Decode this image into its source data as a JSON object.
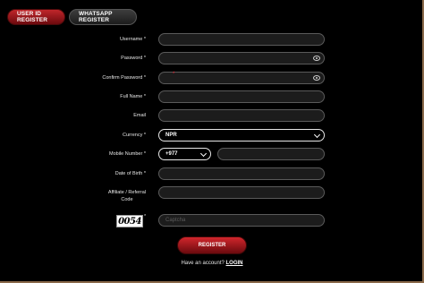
{
  "tabs": [
    {
      "label": "USER ID REGISTER",
      "active": true
    },
    {
      "label": "WHATSAPP REGISTER",
      "active": false
    }
  ],
  "form": {
    "username_label": "Username *",
    "password_label": "Password *",
    "confirm_password_label": "Confirm Password *",
    "confirm_password_hint": "*",
    "full_name_label": "Full Name *",
    "email_label": "Email",
    "currency_label": "Currency *",
    "currency_value": "NPR",
    "mobile_label": "Mobile Number *",
    "country_code": "+977",
    "dob_label": "Date of Birth *",
    "affiliate_label_line1": "Affiliate / Referral",
    "affiliate_label_line2": "Code",
    "captcha_image_text": "0054",
    "captcha_star": "*",
    "captcha_placeholder": "Captcha"
  },
  "actions": {
    "register_label": "REGISTER",
    "have_account_text": "Have an account?",
    "login_label": "LOGIN"
  },
  "colors": {
    "accent_red": "#c0262b",
    "background": "#000000",
    "border": "#8a6a4a"
  }
}
